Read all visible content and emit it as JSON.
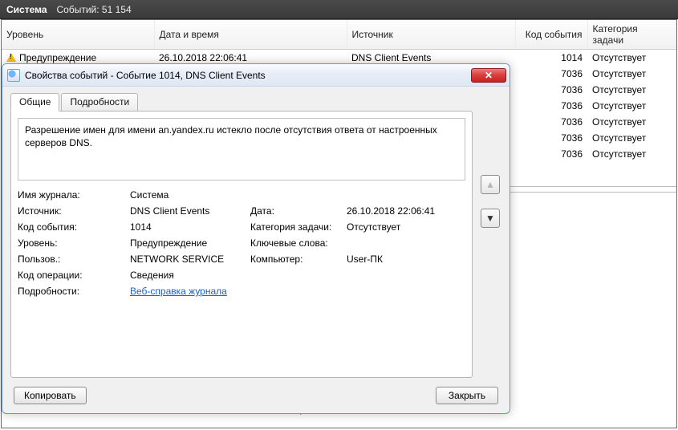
{
  "header": {
    "title": "Система",
    "count_label": "Событий: 51 154"
  },
  "columns": {
    "level": "Уровень",
    "datetime": "Дата и время",
    "source": "Источник",
    "event_id": "Код события",
    "task_cat": "Категория задачи"
  },
  "rows": [
    {
      "level": "Предупреждение",
      "datetime": "26.10.2018 22:06:41",
      "source": "DNS Client Events",
      "event_id": "1014",
      "task_cat": "Отсутствует",
      "icon": "warning"
    },
    {
      "level": "",
      "datetime": "",
      "source": "",
      "event_id": "7036",
      "task_cat": "Отсутствует",
      "icon": ""
    },
    {
      "level": "",
      "datetime": "",
      "source": "",
      "event_id": "7036",
      "task_cat": "Отсутствует",
      "icon": ""
    },
    {
      "level": "",
      "datetime": "",
      "source": "",
      "event_id": "7036",
      "task_cat": "Отсутствует",
      "icon": ""
    },
    {
      "level": "",
      "datetime": "",
      "source": "",
      "event_id": "7036",
      "task_cat": "Отсутствует",
      "icon": ""
    },
    {
      "level": "",
      "datetime": "",
      "source": "",
      "event_id": "7036",
      "task_cat": "Отсутствует",
      "icon": ""
    },
    {
      "level": "",
      "datetime": "",
      "source": "",
      "event_id": "7036",
      "task_cat": "Отсутствует",
      "icon": ""
    }
  ],
  "bg_details": {
    "user_label": "Пользов.:",
    "user_value": "NETWORK SERVICE",
    "computer_label": "Компьютер:"
  },
  "dialog": {
    "title": "Свойства событий - Событие 1014, DNS Client Events",
    "tabs": {
      "general": "Общие",
      "details": "Подробности"
    },
    "description": "Разрешение имен для имени an.yandex.ru истекло после отсутствия ответа от настроенных серверов DNS.",
    "labels": {
      "journal": "Имя журнала:",
      "source": "Источник:",
      "event_id": "Код события:",
      "level": "Уровень:",
      "user": "Пользов.:",
      "opcode": "Код операции:",
      "details": "Подробности:",
      "date": "Дата:",
      "task_cat": "Категория задачи:",
      "keywords": "Ключевые слова:",
      "computer": "Компьютер:"
    },
    "values": {
      "journal": "Система",
      "source": "DNS Client Events",
      "event_id": "1014",
      "level": "Предупреждение",
      "user": "NETWORK SERVICE",
      "opcode": "Сведения",
      "date": "26.10.2018 22:06:41",
      "task_cat": "Отсутствует",
      "keywords": "",
      "computer": "User-ПК",
      "details_link": "Веб-справка журнала"
    },
    "buttons": {
      "copy": "Копировать",
      "close": "Закрыть"
    }
  }
}
